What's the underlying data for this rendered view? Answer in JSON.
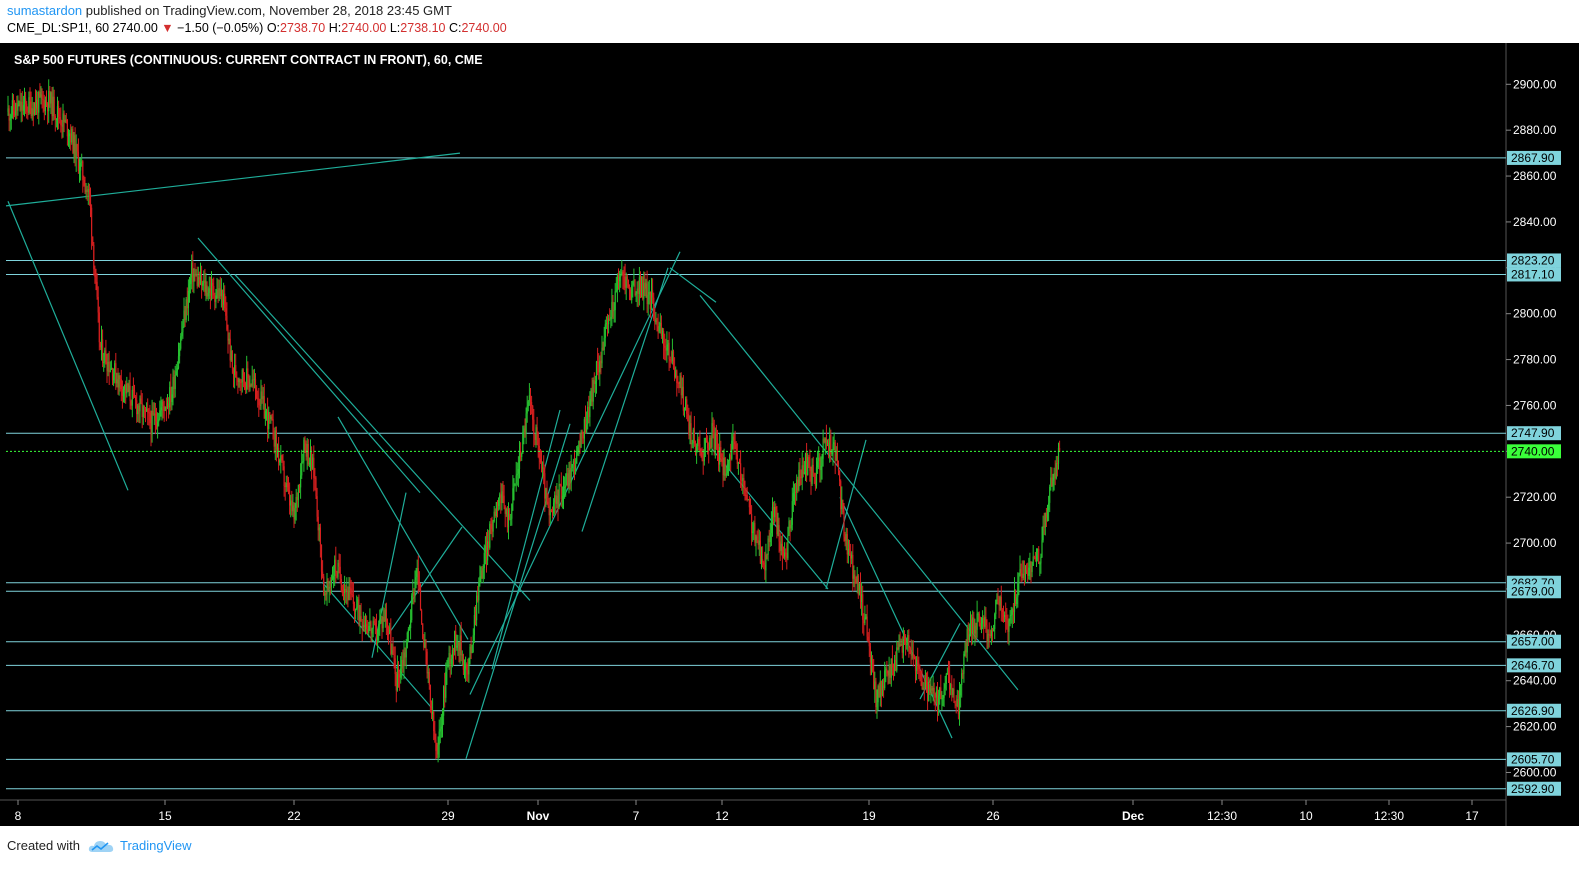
{
  "header": {
    "author": "sumastardon",
    "published_text": "published on TradingView.com, November 28, 2018 23:45 GMT",
    "symbol": "CME_DL:SP1!, 60",
    "last": "2740.00",
    "change": "−1.50 (−0.05%)",
    "o_label": "O:",
    "o_value": "2738.70",
    "h_label": "H:",
    "h_value": "2740.00",
    "l_label": "L:",
    "l_value": "2738.10",
    "c_label": "C:",
    "c_value": "2740.00"
  },
  "footer": {
    "created_with": "Created with",
    "brand": "TradingView"
  },
  "colors": {
    "background": "#000000",
    "level_line": "#7fd3dc",
    "trend_line": "#1fae9a",
    "up_candle": "#26c030",
    "down_candle": "#d61f1f",
    "current_price": "#3aff3a",
    "label_bg": "#7fd3dc"
  },
  "chart_data": {
    "type": "candlestick",
    "title": "S&P 500 FUTURES (CONTINUOUS: CURRENT CONTRACT IN FRONT), 60, CME",
    "y_range": [
      2588,
      2918
    ],
    "y_ticks": [
      2600,
      2620,
      2640,
      2660,
      2680,
      2700,
      2720,
      2740,
      2760,
      2780,
      2800,
      2820,
      2840,
      2860,
      2880,
      2900
    ],
    "y_tick_labels": [
      "2600.00",
      "2620.00",
      "2640.00",
      "2660.00",
      "2680.00",
      "2700.00",
      "2720.00",
      "2740.00",
      "2760.00",
      "2780.00",
      "2800.00",
      "2820.00",
      "2840.00",
      "2860.00",
      "2880.00",
      "2900.00"
    ],
    "x_tick_labels": [
      "8",
      "15",
      "22",
      "29",
      "Nov",
      "7",
      "12",
      "19",
      "26",
      "Dec",
      "12:30",
      "10",
      "12:30",
      "17"
    ],
    "current_price": {
      "value": 2740.0,
      "label": "2740.00"
    },
    "horizontal_levels": [
      {
        "value": 2867.9,
        "label": "2867.90"
      },
      {
        "value": 2823.2,
        "label": "2823.20"
      },
      {
        "value": 2817.1,
        "label": "2817.10"
      },
      {
        "value": 2747.9,
        "label": "2747.90"
      },
      {
        "value": 2682.7,
        "label": "2682.70"
      },
      {
        "value": 2679.0,
        "label": "2679.00"
      },
      {
        "value": 2657.0,
        "label": "2657.00"
      },
      {
        "value": 2646.7,
        "label": "2646.70"
      },
      {
        "value": 2626.9,
        "label": "2626.90"
      },
      {
        "value": 2605.7,
        "label": "2605.70"
      },
      {
        "value": 2592.9,
        "label": "2592.90"
      }
    ],
    "price_path": [
      [
        0,
        2888
      ],
      [
        4,
        2893
      ],
      [
        6,
        2880
      ],
      [
        8,
        2850
      ],
      [
        9,
        2785
      ],
      [
        11,
        2770
      ],
      [
        14,
        2752
      ],
      [
        16,
        2765
      ],
      [
        18,
        2818
      ],
      [
        19,
        2812
      ],
      [
        21,
        2808
      ],
      [
        22,
        2775
      ],
      [
        24,
        2770
      ],
      [
        26,
        2748
      ],
      [
        27,
        2728
      ],
      [
        28,
        2710
      ],
      [
        29,
        2745
      ],
      [
        30,
        2730
      ],
      [
        31,
        2675
      ],
      [
        32,
        2690
      ],
      [
        34,
        2672
      ],
      [
        36,
        2660
      ],
      [
        37,
        2670
      ],
      [
        38,
        2640
      ],
      [
        39,
        2655
      ],
      [
        40,
        2690
      ],
      [
        41,
        2645
      ],
      [
        42,
        2605
      ],
      [
        43,
        2648
      ],
      [
        44,
        2660
      ],
      [
        45,
        2642
      ],
      [
        46,
        2680
      ],
      [
        47,
        2700
      ],
      [
        48,
        2722
      ],
      [
        49,
        2710
      ],
      [
        50,
        2735
      ],
      [
        51,
        2762
      ],
      [
        52,
        2740
      ],
      [
        53,
        2710
      ],
      [
        54,
        2722
      ],
      [
        55,
        2730
      ],
      [
        56,
        2742
      ],
      [
        57,
        2762
      ],
      [
        58,
        2782
      ],
      [
        59,
        2800
      ],
      [
        60,
        2818
      ],
      [
        61,
        2810
      ],
      [
        62,
        2812
      ],
      [
        63,
        2806
      ],
      [
        64,
        2790
      ],
      [
        65,
        2780
      ],
      [
        66,
        2765
      ],
      [
        67,
        2745
      ],
      [
        68,
        2740
      ],
      [
        69,
        2748
      ],
      [
        70,
        2732
      ],
      [
        71,
        2742
      ],
      [
        72,
        2725
      ],
      [
        73,
        2705
      ],
      [
        74,
        2690
      ],
      [
        75,
        2715
      ],
      [
        76,
        2690
      ],
      [
        77,
        2722
      ],
      [
        78,
        2735
      ],
      [
        79,
        2728
      ],
      [
        80,
        2745
      ],
      [
        81,
        2740
      ],
      [
        82,
        2700
      ],
      [
        83,
        2685
      ],
      [
        84,
        2665
      ],
      [
        85,
        2632
      ],
      [
        86,
        2642
      ],
      [
        87,
        2650
      ],
      [
        88,
        2660
      ],
      [
        89,
        2645
      ],
      [
        90,
        2635
      ],
      [
        91,
        2630
      ],
      [
        92,
        2640
      ],
      [
        93,
        2628
      ],
      [
        94,
        2662
      ],
      [
        95,
        2668
      ],
      [
        96,
        2660
      ],
      [
        97,
        2675
      ],
      [
        98,
        2663
      ],
      [
        99,
        2685
      ],
      [
        100,
        2690
      ],
      [
        101,
        2695
      ],
      [
        102,
        2722
      ],
      [
        103,
        2740
      ]
    ]
  }
}
